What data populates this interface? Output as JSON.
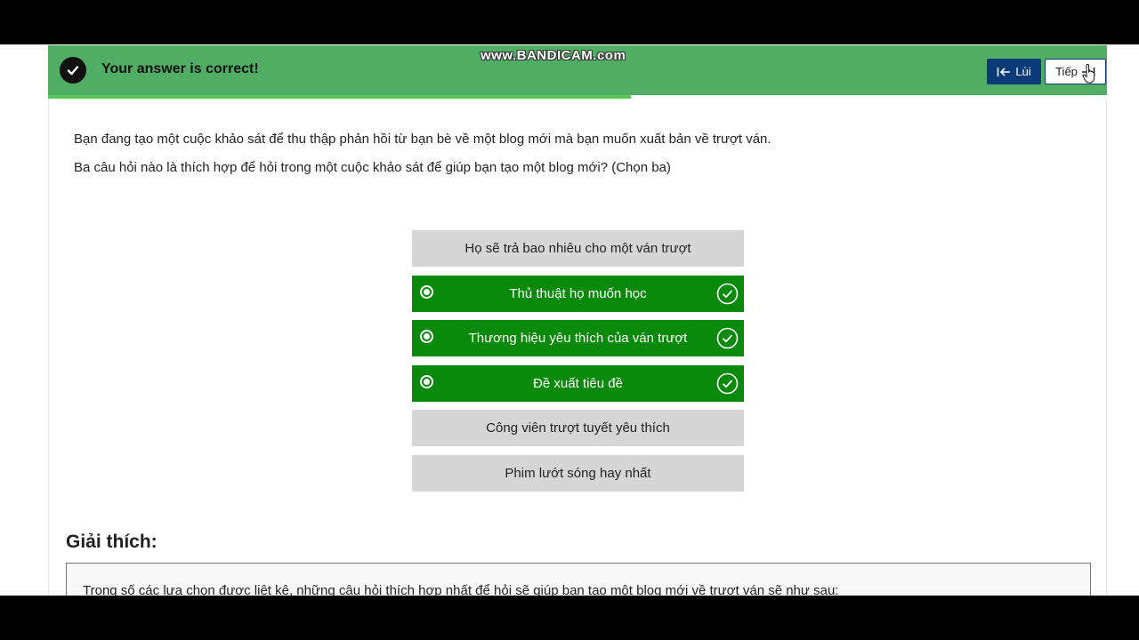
{
  "recording": {
    "watermark": "www.BANDICAM.com"
  },
  "feedback": {
    "message": "Your answer is correct!",
    "back_label": "Lùi",
    "next_label": "Tiếp",
    "progress_percent": 55
  },
  "question": {
    "line1": "Bạn đang tạo một cuộc khảo sát để thu thập phản hồi từ bạn bè về một blog mới mà bạn muốn xuất bản về trượt ván.",
    "line2": "Ba câu hỏi nào là thích hợp để hỏi trong một cuộc khảo sát để giúp bạn tạo một blog mới? (Chọn ba)"
  },
  "options": [
    {
      "label": "Họ sẽ trả bao nhiêu cho một ván trượt",
      "selected": false,
      "correct": false
    },
    {
      "label": "Thủ thuật họ muốn học",
      "selected": true,
      "correct": true
    },
    {
      "label": "Thương hiệu yêu thích của ván trượt",
      "selected": true,
      "correct": true
    },
    {
      "label": "Đề xuất tiêu đề",
      "selected": true,
      "correct": true
    },
    {
      "label": "Công viên trượt tuyết yêu thích",
      "selected": false,
      "correct": false
    },
    {
      "label": "Phim lướt sóng hay nhất",
      "selected": false,
      "correct": false
    }
  ],
  "explanation": {
    "title": "Giải thích:",
    "text": "Trong số các lựa chọn được liệt kê, những câu hỏi thích hợp nhất để hỏi sẽ giúp bạn tạo một blog mới về trượt ván sẽ như sau:"
  },
  "colors": {
    "feedback_bg": "#4fae64",
    "correct_option": "#0a8a0a",
    "neutral_option": "#d6d6d6",
    "back_button": "#0b3a78"
  }
}
